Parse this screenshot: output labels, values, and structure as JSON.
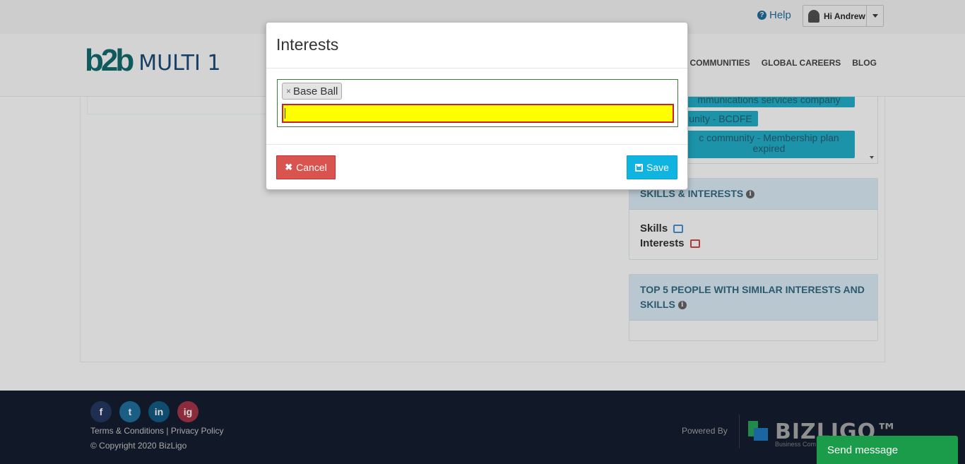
{
  "topbar": {
    "help_label": "Help",
    "user_greeting": "Hi Andrew"
  },
  "header": {
    "logo_mark": "b2b",
    "logo_text": "MULTI 1",
    "nav": [
      "L COMMUNITIES",
      "GLOBAL CAREERS",
      "BLOG"
    ]
  },
  "communities": {
    "tags": [
      "mmunications services company",
      "unity - BCDFE",
      "c community - Membership plan expired"
    ]
  },
  "skills_panel": {
    "title": "SKILLS & INTERESTS",
    "skills_label": "Skills",
    "interests_label": "Interests"
  },
  "top5_panel": {
    "title": "TOP 5 PEOPLE WITH SIMILAR INTERESTS AND SKILLS"
  },
  "modal": {
    "title": "Interests",
    "selected_tags": [
      "Base Ball"
    ],
    "input_value": "",
    "cancel_label": "Cancel",
    "save_label": "Save"
  },
  "footer": {
    "social": [
      "f",
      "t",
      "in",
      "ig"
    ],
    "links_text": "Terms & Conditions | Privacy Policy",
    "copyright": "© Copyright 2020 BizLigo",
    "powered_by": "Powered By",
    "brand": "BIZLIGO™",
    "brand_sub": "Business Com"
  },
  "chat": {
    "send_message_label": "Send message"
  },
  "colors": {
    "modal_input_highlight": "#ffff00",
    "cancel_button": "#d9534f",
    "save_button": "#10b4e0",
    "send_message": "#1a9c4a"
  }
}
